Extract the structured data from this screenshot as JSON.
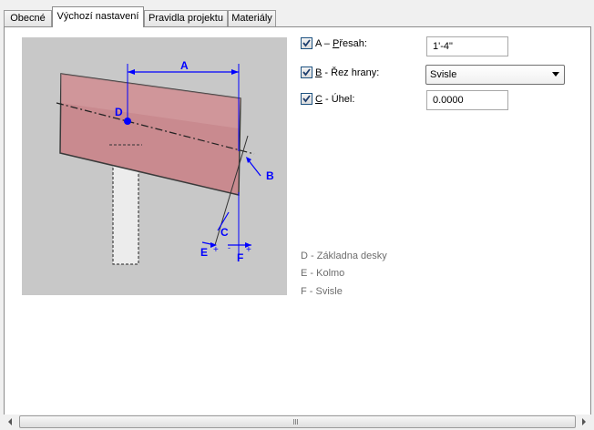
{
  "tabs": [
    {
      "label": "Obecné",
      "active": false
    },
    {
      "label": "Výchozí nastavení",
      "active": true
    },
    {
      "label": "Pravidla projektu",
      "active": false
    },
    {
      "label": "Materiály",
      "active": false
    }
  ],
  "options": {
    "overhang": {
      "prefix": "A – ",
      "accel": "P",
      "rest": "řesah:",
      "checked": true,
      "value": "1'-4\""
    },
    "edge_cut": {
      "accel": "B",
      "rest": " - Řez hrany:",
      "checked": true,
      "selected": "Svisle"
    },
    "angle": {
      "accel": "C",
      "rest": " - Úhel:",
      "checked": true,
      "value": "0.0000"
    }
  },
  "diagram": {
    "labels": {
      "a": "A",
      "b": "B",
      "c": "C",
      "d": "D",
      "e": "E",
      "f": "F"
    },
    "colors": {
      "annotation": "#0000ff",
      "rafter": "#c98a8f",
      "background": "#c8c8c8"
    }
  },
  "legend": [
    "D - Základna desky",
    "E - Kolmo",
    "F - Svisle"
  ],
  "scrollbar": {
    "grip": "III"
  }
}
